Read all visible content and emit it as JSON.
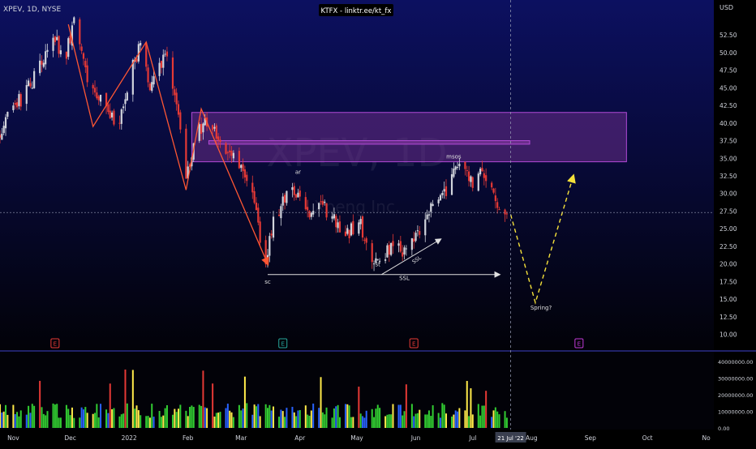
{
  "header": {
    "symbol": "XPEV, 1D, NYSE",
    "banner": "KTFX - linktr.ee/kt_fx"
  },
  "watermark": {
    "ticker": "XPEV, 1D",
    "company": "Xpeng Inc."
  },
  "colors": {
    "bg_top": "#0c1060",
    "bg_bottom": "#020208",
    "up": "#d1d4dc",
    "down": "#e53935",
    "zone_fill": "#6a2d8a",
    "zone_stroke": "#b24ad6",
    "swing_line": "#ff5733",
    "projection": "#f5e13a",
    "annotation": "#e0e0e0",
    "vol_green": "#32cd32",
    "vol_yellow": "#ffea4a",
    "vol_red": "#e53935",
    "vol_blue": "#2962ff",
    "earn_red": "#e53935",
    "earn_green": "#26a69a",
    "earn_purple": "#c13ad8"
  },
  "price_axis": {
    "unit": "USD",
    "ticks": [
      "52.50",
      "50.00",
      "47.50",
      "45.00",
      "42.50",
      "40.00",
      "37.50",
      "35.00",
      "32.50",
      "30.00",
      "27.50",
      "25.00",
      "22.50",
      "20.00",
      "17.50",
      "15.00",
      "12.50",
      "10.00"
    ]
  },
  "volume_axis": {
    "ticks": [
      "40000000.00",
      "30000000.00",
      "20000000.00",
      "10000000.00",
      "0.00"
    ]
  },
  "time_axis": {
    "labels": [
      "Nov",
      "Dec",
      "2022",
      "Feb",
      "Mar",
      "Apr",
      "May",
      "Jun",
      "Jul",
      "Aug",
      "Sep",
      "Oct",
      "No"
    ],
    "cursor_date": "21 Jul '22"
  },
  "annotations": {
    "sc": "sc",
    "ar": "ar",
    "st": "st",
    "ssl_flat": "SSL",
    "ssl_diag": "SSL",
    "msos": "msos",
    "spring": "Spring?"
  },
  "earnings_marker": "E",
  "chart_data": {
    "type": "candlestick",
    "title": "XPEV, 1D, NYSE",
    "ylabel": "USD",
    "ylim": [
      8,
      57
    ],
    "volume_ylim": [
      0,
      45000000
    ],
    "date_range": [
      "2021-10-25",
      "2022-11-05"
    ],
    "month_ticks": [
      {
        "date": "2021-11-01",
        "label": "Nov"
      },
      {
        "date": "2021-12-01",
        "label": "Dec"
      },
      {
        "date": "2022-01-01",
        "label": "2022"
      },
      {
        "date": "2022-02-01",
        "label": "Feb"
      },
      {
        "date": "2022-03-01",
        "label": "Mar"
      },
      {
        "date": "2022-04-01",
        "label": "Apr"
      },
      {
        "date": "2022-05-01",
        "label": "May"
      },
      {
        "date": "2022-06-01",
        "label": "Jun"
      },
      {
        "date": "2022-07-01",
        "label": "Jul"
      },
      {
        "date": "2022-08-01",
        "label": "Aug"
      },
      {
        "date": "2022-09-01",
        "label": "Sep"
      },
      {
        "date": "2022-10-01",
        "label": "Oct"
      },
      {
        "date": "2022-11-01",
        "label": "No"
      }
    ],
    "close_path": [
      [
        "2021-10-25",
        38.5
      ],
      [
        "2021-11-01",
        42.0
      ],
      [
        "2021-11-08",
        44.5
      ],
      [
        "2021-11-15",
        48.0
      ],
      [
        "2021-11-22",
        52.5
      ],
      [
        "2021-11-28",
        49.0
      ],
      [
        "2021-12-03",
        54.0
      ],
      [
        "2021-12-07",
        50.5
      ],
      [
        "2021-12-10",
        46.0
      ],
      [
        "2021-12-20",
        42.0
      ],
      [
        "2021-12-27",
        40.0
      ],
      [
        "2022-01-03",
        48.0
      ],
      [
        "2022-01-07",
        51.0
      ],
      [
        "2022-01-12",
        45.0
      ],
      [
        "2022-01-18",
        48.5
      ],
      [
        "2022-01-21",
        49.5
      ],
      [
        "2022-01-26",
        43.0
      ],
      [
        "2022-01-31",
        31.5
      ],
      [
        "2022-02-04",
        37.0
      ],
      [
        "2022-02-10",
        40.5
      ],
      [
        "2022-02-18",
        37.5
      ],
      [
        "2022-02-25",
        35.0
      ],
      [
        "2022-03-03",
        32.0
      ],
      [
        "2022-03-08",
        28.5
      ],
      [
        "2022-03-14",
        19.5
      ],
      [
        "2022-03-17",
        25.0
      ],
      [
        "2022-03-24",
        29.5
      ],
      [
        "2022-03-31",
        30.5
      ],
      [
        "2022-04-06",
        27.5
      ],
      [
        "2022-04-12",
        28.5
      ],
      [
        "2022-04-19",
        26.0
      ],
      [
        "2022-04-26",
        24.0
      ],
      [
        "2022-05-02",
        26.5
      ],
      [
        "2022-05-06",
        22.0
      ],
      [
        "2022-05-12",
        20.0
      ],
      [
        "2022-05-19",
        22.5
      ],
      [
        "2022-05-26",
        22.0
      ],
      [
        "2022-06-01",
        24.0
      ],
      [
        "2022-06-08",
        27.5
      ],
      [
        "2022-06-15",
        29.0
      ],
      [
        "2022-06-21",
        33.0
      ],
      [
        "2022-06-24",
        35.0
      ],
      [
        "2022-06-30",
        31.5
      ],
      [
        "2022-07-06",
        33.0
      ],
      [
        "2022-07-12",
        29.5
      ],
      [
        "2022-07-19",
        27.0
      ]
    ],
    "earnings_dates": [
      {
        "date": "2021-11-23",
        "type": "red"
      },
      {
        "date": "2022-03-23",
        "type": "green"
      },
      {
        "date": "2022-05-31",
        "type": "red"
      },
      {
        "date": "2022-08-26",
        "type": "purple"
      }
    ],
    "supply_zone": {
      "from": "2022-02-03",
      "to": "2022-09-20",
      "top": 41.5,
      "bottom": 34.5
    },
    "zone_line": {
      "from": "2022-02-12",
      "to": "2022-07-31",
      "top": 37.5,
      "bottom": 37.0
    },
    "swing_path": [
      [
        "2021-11-30",
        54.0
      ],
      [
        "2021-12-13",
        39.5
      ],
      [
        "2022-01-10",
        51.5
      ],
      [
        "2022-01-31",
        30.5
      ],
      [
        "2022-02-08",
        42.0
      ],
      [
        "2022-03-15",
        20.0
      ]
    ],
    "ssl_flat": {
      "from": "2022-03-15",
      "to": "2022-07-15",
      "price": 18.5
    },
    "ssl_diag": {
      "from": "2022-05-14",
      "y0": 18.5,
      "to": "2022-06-14",
      "y1": 23.5
    },
    "projection": [
      [
        "2022-07-21",
        27.0
      ],
      [
        "2022-08-03",
        14.5
      ],
      [
        "2022-08-23",
        32.5
      ]
    ],
    "current_price": 27.3,
    "cursor_date": "2022-07-21",
    "label_positions": {
      "sc": [
        "2022-03-15",
        17.2
      ],
      "ar": [
        "2022-03-31",
        32.8
      ],
      "st": [
        "2022-05-12",
        19.7
      ],
      "ssl_flat": [
        "2022-05-26",
        17.7
      ],
      "ssl_diag": [
        "2022-06-02",
        20.4
      ],
      "msos": [
        "2022-06-21",
        35.0
      ],
      "spring": [
        "2022-08-06",
        13.5
      ]
    }
  }
}
